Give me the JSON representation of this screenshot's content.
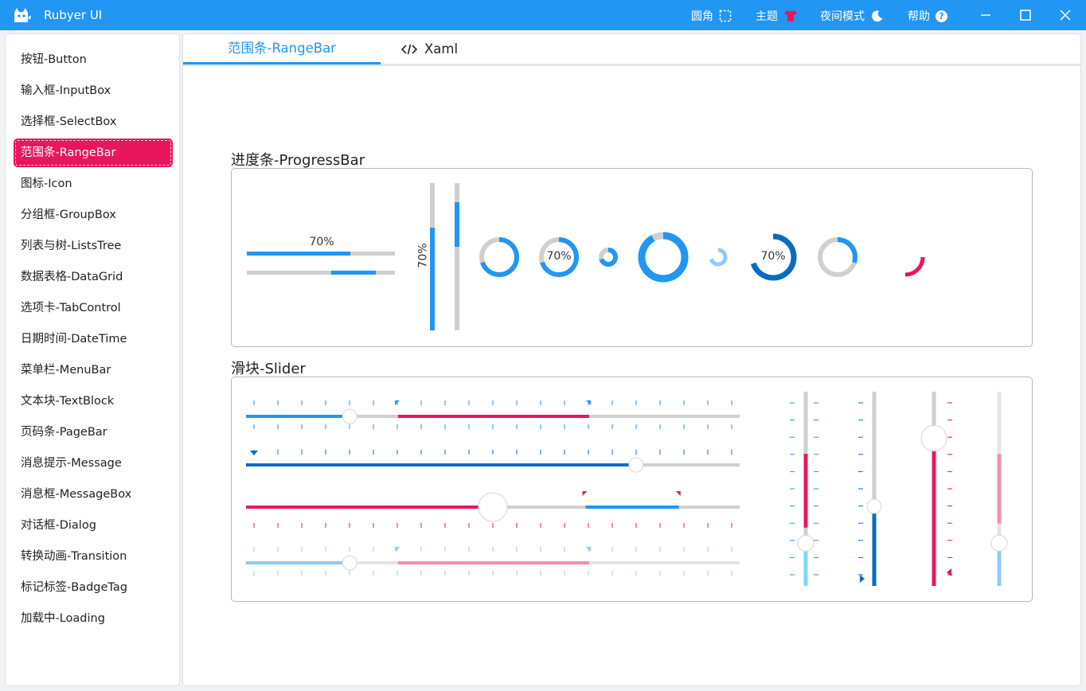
{
  "window": {
    "title": "Rubyer UI"
  },
  "titlebar": {
    "corner_label": "圆角",
    "theme_label": "主题",
    "night_label": "夜间模式",
    "help_label": "帮助",
    "help_glyph": "?"
  },
  "sidebar": {
    "items": [
      {
        "label": "按钮-Button"
      },
      {
        "label": "输入框-InputBox"
      },
      {
        "label": "选择框-SelectBox"
      },
      {
        "label": "范围条-RangeBar",
        "active": true
      },
      {
        "label": "图标-Icon"
      },
      {
        "label": "分组框-GroupBox"
      },
      {
        "label": "列表与树-ListsTree"
      },
      {
        "label": "数据表格-DataGrid"
      },
      {
        "label": "选项卡-TabControl"
      },
      {
        "label": "日期时间-DateTime"
      },
      {
        "label": "菜单栏-MenuBar"
      },
      {
        "label": "文本块-TextBlock"
      },
      {
        "label": "页码条-PageBar"
      },
      {
        "label": "消息提示-Message"
      },
      {
        "label": "消息框-MessageBox"
      },
      {
        "label": "对话框-Dialog"
      },
      {
        "label": "转换动画-Transition"
      },
      {
        "label": "标记标签-BadgeTag"
      },
      {
        "label": "加载中-Loading"
      }
    ]
  },
  "tabs": [
    {
      "label": "范围条-RangeBar",
      "active": true
    },
    {
      "label": "Xaml",
      "icon": "code-icon"
    }
  ],
  "progress": {
    "title": "进度条-ProgressBar",
    "h_bar1": {
      "value": 0.7,
      "label": "70%"
    },
    "h_bar2": {
      "start": 0.57,
      "end": 0.87
    },
    "v_bar1": {
      "value": 0.7,
      "label": "70%"
    },
    "v_bar2": {
      "start": 0.13,
      "end": 0.43
    },
    "rings": [
      {
        "value": 0.7,
        "color": "#2196f3"
      },
      {
        "value": 0.7,
        "color": "#2196f3",
        "label": "70%"
      },
      {
        "value": 0.7,
        "color": "#2196f3"
      },
      {
        "value": 0.92,
        "color": "#2196f3"
      },
      {
        "value": 0.7,
        "color": "#90caf9"
      },
      {
        "value": 0.7,
        "color": "#0b6bc3",
        "label": "70%"
      },
      {
        "value": 0.3,
        "color": "#2196f3"
      },
      {
        "value": 0.25,
        "color": "#e8175d"
      }
    ]
  },
  "slider": {
    "title": "滑块-Slider",
    "h_sliders": [
      {
        "value": 0.21,
        "range": [
          0.308,
          0.695
        ],
        "fill": "#2196f3",
        "range_color": "#e8175d"
      },
      {
        "value": 0.79,
        "fill": "#0b6bc3"
      },
      {
        "value": 0.5,
        "range": [
          0.688,
          0.877
        ],
        "fill": "#e8175d",
        "range_color": "#2196f3"
      },
      {
        "value": 0.21,
        "range": [
          0.308,
          0.695
        ],
        "fill": "#90caf9",
        "range_color": "#f48fb1"
      }
    ],
    "v_sliders": [
      {
        "value": 0.22,
        "range": [
          0.3,
          0.68
        ],
        "fill": "#81d4fa",
        "range_color": "#e8175d"
      },
      {
        "value": 0.41,
        "fill": "#0b6bc3"
      },
      {
        "value": 0.76,
        "fill": "#e8175d"
      },
      {
        "value": 0.22,
        "range": [
          0.32,
          0.68
        ],
        "fill": "#90caf9",
        "range_color": "#f48fb1"
      }
    ]
  },
  "colors": {
    "primary": "#2196f3",
    "accent": "#e8175d",
    "dark_blue": "#0b6bc3",
    "light_blue": "#90caf9",
    "track": "#cfcfcf"
  }
}
